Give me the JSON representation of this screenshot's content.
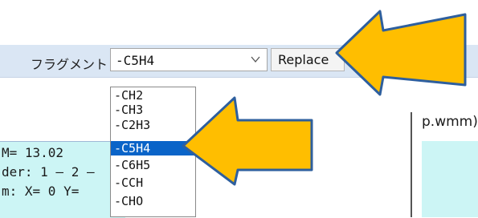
{
  "toolbar": {
    "fragment_label": "フラグメント",
    "combo_value": "-C5H4",
    "replace_label": "Replace"
  },
  "dropdown": {
    "options": [
      "-CH2",
      "-CH3",
      "-C2H3",
      "-C5H4",
      "-C6H5",
      "-CCH",
      "-CHO"
    ],
    "selected": "-C5H4"
  },
  "info": {
    "line1": "M= 13.02",
    "line2": "der: 1 – 2 –",
    "line3": "m: X= 0 Y="
  },
  "file": {
    "label": "p.wmm)"
  },
  "colors": {
    "toolbar_bg": "#dae6f4",
    "panel_bg": "#ccf5f5",
    "selection": "#0a64c8",
    "arrow_fill": "#ffbe00",
    "arrow_outline": "#2e5f9e"
  },
  "icons": {
    "combo_arrow": "chevron-down-icon",
    "annotations": "arrow-left-icon"
  }
}
